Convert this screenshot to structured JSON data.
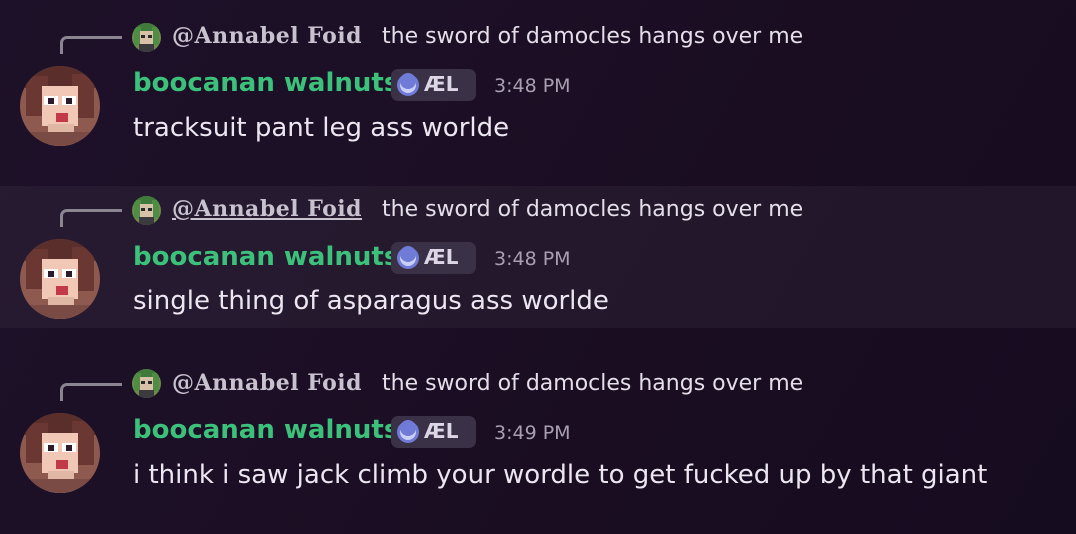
{
  "messages": [
    {
      "reply_author": "@Annabel Foid",
      "reply_text": "the sword of damocles hangs over me",
      "author": "boocanan walnuts",
      "tag": "ÆL",
      "time": "3:48 PM",
      "content": "tracksuit pant leg ass worlde"
    },
    {
      "reply_author": "@Annabel Foid",
      "reply_text": "the sword of damocles hangs over me",
      "author": "boocanan walnuts",
      "tag": "ÆL",
      "time": "3:48 PM",
      "content": "single thing of asparagus ass worlde"
    },
    {
      "reply_author": "@Annabel Foid",
      "reply_text": "the sword of damocles hangs over me",
      "author": "boocanan walnuts",
      "tag": "ÆL",
      "time": "3:49 PM",
      "content": "i think i saw jack climb your wordle to get fucked up by that giant"
    }
  ],
  "colors": {
    "username": "#3cc17b",
    "reply_author": "#c8c2cf",
    "tag_bg": "#3a3147",
    "hover_bg": "rgba(255,255,255,0.045)"
  },
  "icons": {
    "reply_avatar": "pixel-art-avatar-green-hair",
    "author_avatar": "pixel-art-avatar-brown-hair-glasses",
    "tag_icon": "moon-icon"
  }
}
